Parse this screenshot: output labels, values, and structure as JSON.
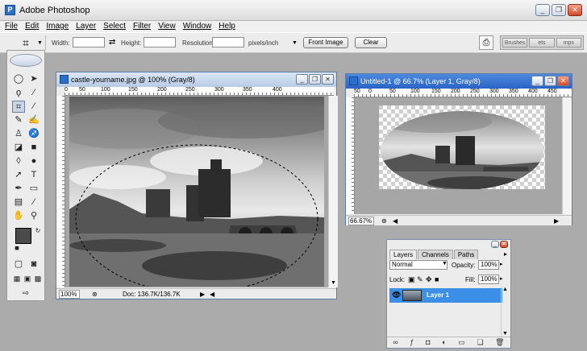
{
  "app": {
    "title": "Adobe Photoshop"
  },
  "menu": [
    "File",
    "Edit",
    "Image",
    "Layer",
    "Select",
    "Filter",
    "View",
    "Window",
    "Help"
  ],
  "options": {
    "width_label": "Width:",
    "height_label": "Height:",
    "resolution_label": "Resolution:",
    "units_value": "pixels/inch",
    "front_image_label": "Front Image",
    "clear_label": "Clear"
  },
  "palette_well": [
    "Brushes",
    "ets",
    "mps"
  ],
  "doc1": {
    "title": "castle-yourname.jpg @ 100% (Gray/8)",
    "ruler": [
      "0",
      "50",
      "100",
      "150",
      "200",
      "250",
      "300",
      "350",
      "400"
    ],
    "zoom": "100%",
    "status": "Doc: 136.7K/136.7K"
  },
  "doc2": {
    "title": "Untitled-1 @ 66.7% (Layer 1, Gray/8)",
    "ruler": [
      "50",
      "0",
      "50",
      "100",
      "150",
      "200",
      "250",
      "300",
      "350",
      "400",
      "450"
    ],
    "zoom": "66.67%"
  },
  "layers_panel": {
    "tabs": [
      "Layers",
      "Channels",
      "Paths"
    ],
    "blend_mode": "Normal",
    "opacity_label": "Opacity:",
    "opacity_value": "100%",
    "lock_label": "Lock:",
    "fill_label": "Fill:",
    "fill_value": "100%",
    "layer_name": "Layer 1"
  }
}
